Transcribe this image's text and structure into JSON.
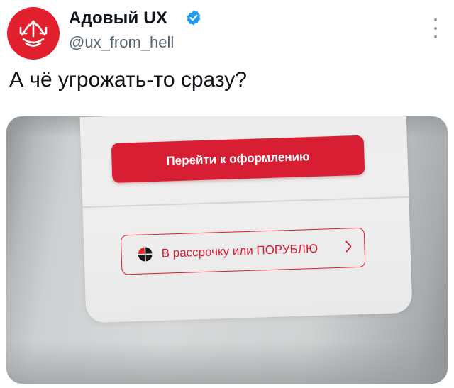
{
  "tweet": {
    "display_name": "Адовый UX",
    "handle": "@ux_from_hell",
    "text": "А чё угрожать-то сразу?",
    "avatar_icon": "trident-logo-icon",
    "verified_icon": "verified-badge-icon",
    "menu_icon": "more-options-icon"
  },
  "photo": {
    "checkout_button_label": "Перейти к оформлению",
    "installment_button_label": "В рассрочку или ПОРУБЛЮ",
    "installment_logo_icon": "dolyame-logo-icon",
    "installment_chevron_icon": "chevron-right-icon"
  },
  "colors": {
    "brand_red": "#d81e33",
    "avatar_red": "#e11f2d",
    "verified_blue": "#1d9bf0",
    "handle_gray": "#536471"
  }
}
